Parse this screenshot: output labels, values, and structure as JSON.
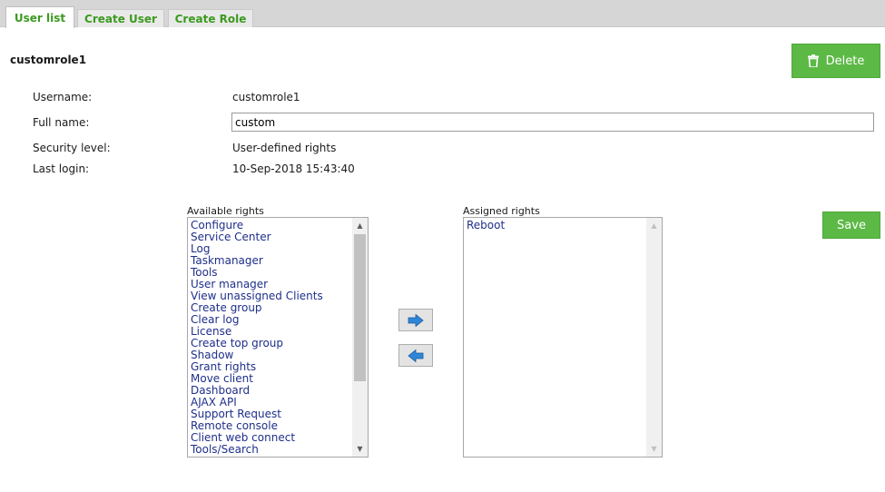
{
  "tabs": [
    {
      "label": "User list",
      "active": true
    },
    {
      "label": "Create User",
      "active": false
    },
    {
      "label": "Create Role",
      "active": false
    }
  ],
  "user": {
    "title": "customrole1",
    "delete_label": "Delete",
    "fields": {
      "username_label": "Username:",
      "username_value": "customrole1",
      "fullname_label": "Full name:",
      "fullname_value": "custom",
      "security_label": "Security level:",
      "security_value": "User-defined rights",
      "lastlogin_label": "Last login:",
      "lastlogin_value": "10-Sep-2018 15:43:40"
    }
  },
  "rights": {
    "available_caption": "Available rights",
    "assigned_caption": "Assigned rights",
    "available": [
      "Configure",
      "Service Center",
      "Log",
      "Taskmanager",
      "Tools",
      "User manager",
      "View unassigned Clients",
      "Create group",
      "Clear log",
      "License",
      "Create top group",
      "Shadow",
      "Grant rights",
      "Move client",
      "Dashboard",
      "AJAX API",
      "Support Request",
      "Remote console",
      "Client web connect",
      "Tools/Search"
    ],
    "assigned": [
      "Reboot"
    ],
    "save_label": "Save"
  },
  "icons": {
    "delete": "trash-icon",
    "move_right": "arrow-right-icon",
    "move_left": "arrow-left-icon"
  },
  "colors": {
    "accent_green": "#5cb946",
    "tab_text": "#3b9a1f",
    "list_text": "#1f2f8a",
    "arrow_blue": "#2f86d8"
  }
}
